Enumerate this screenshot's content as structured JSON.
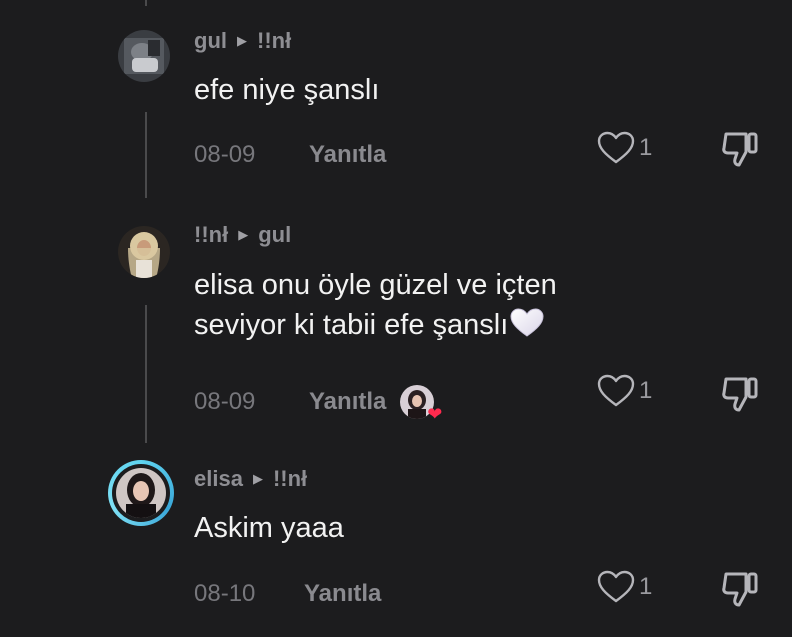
{
  "comments": [
    {
      "author": "gul",
      "reply_to": "!!nł",
      "text": "efe niye şanslı",
      "date": "08-09",
      "reply_label": "Yanıtla",
      "likes": "1"
    },
    {
      "author": "!!nł",
      "reply_to": "gul",
      "text_line1": "elisa onu öyle güzel ve içten",
      "text_line2": "seviyor ki tabii efe şanslı",
      "date": "08-09",
      "reply_label": "Yanıtla",
      "likes": "1"
    },
    {
      "author": "elisa",
      "reply_to": "!!nł",
      "text": "Askim yaaa",
      "date": "08-10",
      "reply_label": "Yanıtla",
      "likes": "1"
    }
  ],
  "icons": {
    "reply_arrow": "triangle-right-icon",
    "like": "heart-outline-icon",
    "dislike": "thumbs-down-icon",
    "emoji": "white-heart-emoji",
    "creator_like": "creator-liked-heart-icon"
  },
  "colors": {
    "background": "#1c1c1e",
    "text": "#f2f2f2",
    "meta": "#8e8e93",
    "story_ring": "#5fd3ef",
    "red_heart": "#ff2a4e"
  }
}
